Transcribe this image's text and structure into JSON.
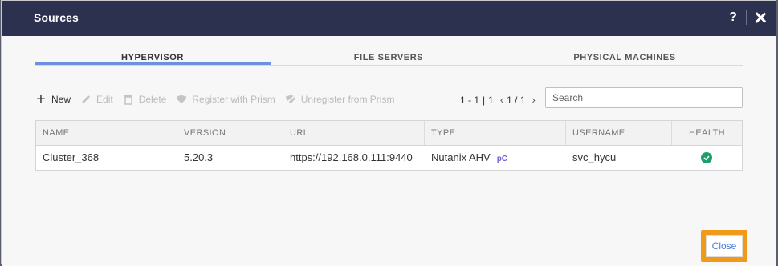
{
  "dialog": {
    "title": "Sources",
    "help_label": "?"
  },
  "tabs": [
    {
      "label": "HYPERVISOR",
      "active": true
    },
    {
      "label": "FILE SERVERS",
      "active": false
    },
    {
      "label": "PHYSICAL MACHINES",
      "active": false
    }
  ],
  "toolbar": {
    "new_label": "New",
    "edit_label": "Edit",
    "delete_label": "Delete",
    "register_label": "Register with Prism",
    "unregister_label": "Unregister from Prism"
  },
  "pager": {
    "range": "1 - 1",
    "separator": "|",
    "total": "1",
    "pages": "1 / 1"
  },
  "search": {
    "placeholder": "Search",
    "value": ""
  },
  "table": {
    "columns": [
      "NAME",
      "VERSION",
      "URL",
      "TYPE",
      "USERNAME",
      "HEALTH"
    ],
    "rows": [
      {
        "name": "Cluster_368",
        "version": "5.20.3",
        "url": "https://192.168.0.111:9440",
        "type": "Nutanix AHV",
        "type_badge": "pC",
        "username": "svc_hycu",
        "health": "ok"
      }
    ]
  },
  "footer": {
    "close_label": "Close"
  },
  "colors": {
    "titlebar": "#2d3150",
    "tab_accent": "#6e8ee2",
    "health_ok": "#1aa06b",
    "close_highlight": "#f19a1a",
    "link": "#4a7bd6"
  },
  "icons": {
    "new": "plus-icon",
    "edit": "pencil-icon",
    "delete": "trash-icon",
    "register": "tag-icon",
    "unregister": "tag-slash-icon",
    "health": "check-circle-icon",
    "close": "close-icon"
  }
}
